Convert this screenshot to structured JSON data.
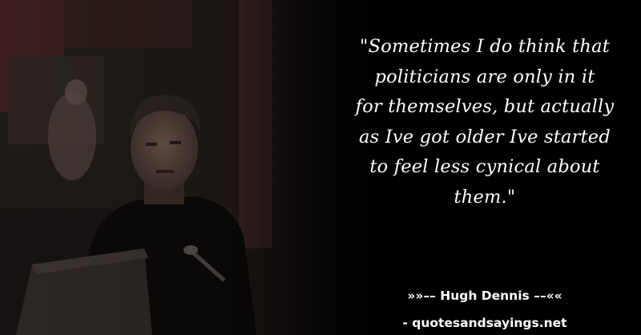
{
  "quote": {
    "lines": [
      "\"Sometimes I do think that",
      "politicians are only in it",
      "for themselves, but actually",
      "as Ive got older Ive started",
      "to feel less cynical about",
      "them.\""
    ]
  },
  "attribution": {
    "author": "»»–– Hugh Dennis ––««",
    "source": "- quotesandsayings.net"
  }
}
